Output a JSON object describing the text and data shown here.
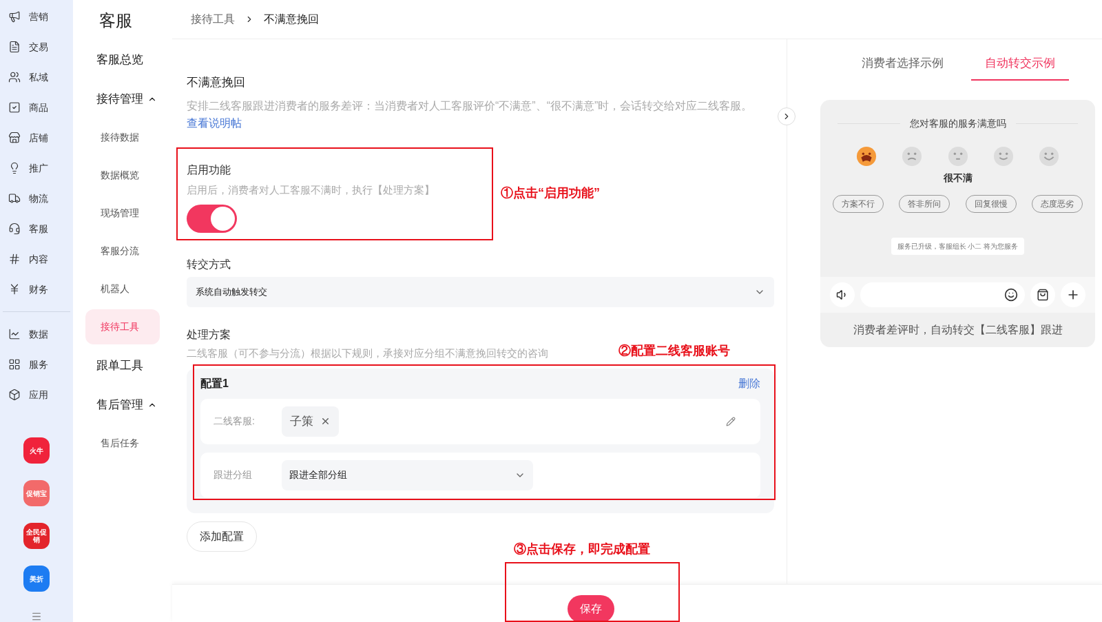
{
  "nav_rail": {
    "items": [
      {
        "label": "营销"
      },
      {
        "label": "交易"
      },
      {
        "label": "私域"
      },
      {
        "label": "商品"
      },
      {
        "label": "店铺"
      },
      {
        "label": "推广"
      },
      {
        "label": "物流"
      },
      {
        "label": "客服"
      },
      {
        "label": "内容"
      },
      {
        "label": "财务"
      },
      {
        "label": "数据"
      },
      {
        "label": "服务"
      },
      {
        "label": "应用"
      }
    ],
    "apps": [
      {
        "label": "火牛",
        "color": "#f0233b"
      },
      {
        "label": "促销宝",
        "color": "#f26a6a"
      },
      {
        "label": "全民促销",
        "color": "#e3242b"
      },
      {
        "label": "美折",
        "color": "#1d7cf2"
      }
    ]
  },
  "submenu": {
    "title": "客服",
    "items": [
      {
        "label": "客服总览",
        "kind": "link"
      },
      {
        "label": "接待管理",
        "kind": "group",
        "expanded": true,
        "children": [
          {
            "label": "接待数据",
            "selected": false
          },
          {
            "label": "数据概览",
            "selected": false
          },
          {
            "label": "现场管理",
            "selected": false
          },
          {
            "label": "客服分流",
            "selected": false
          },
          {
            "label": "机器人",
            "selected": false
          },
          {
            "label": "接待工具",
            "selected": true
          }
        ]
      },
      {
        "label": "跟单工具",
        "kind": "link"
      },
      {
        "label": "售后管理",
        "kind": "group",
        "expanded": true,
        "children": [
          {
            "label": "售后任务",
            "selected": false
          }
        ]
      }
    ]
  },
  "breadcrumb": [
    "接待工具",
    "不满意挽回"
  ],
  "form": {
    "title": "不满意挽回",
    "description": "安排二线客服跟进消费者的服务差评：当消费者对人工客服评价“不满意”、“很不满意”时，会话转交给对应二线客服。",
    "help_link": "查看说明帖",
    "enable": {
      "label": "启用功能",
      "hint": "启用后，消费者对人工客服不满时，执行【处理方案】",
      "on": true
    },
    "transfer": {
      "label": "转交方式",
      "value": "系统自动触发转交"
    },
    "plan": {
      "label": "处理方案",
      "hint": "二线客服（可不参与分流）根据以下规则，承接对应分组不满意挽回转交的咨询",
      "configs": [
        {
          "title": "配置1",
          "delete": "删除",
          "agent_label": "二线客服:",
          "agents": [
            "子策"
          ],
          "group_label": "跟进分组",
          "group_value": "跟进全部分组"
        }
      ]
    },
    "add_button": "添加配置",
    "save_button": "保存"
  },
  "annotations": [
    "①点击“启用功能”",
    "②配置二线客服账号",
    "③点击保存，即完成配置"
  ],
  "preview": {
    "tabs": [
      {
        "label": "消费者选择示例",
        "selected": false
      },
      {
        "label": "自动转交示例",
        "selected": true
      }
    ],
    "question": "您对客服的服务满意吗",
    "faces": [
      {
        "selected": true
      },
      {
        "selected": false
      },
      {
        "selected": false
      },
      {
        "selected": false
      },
      {
        "selected": false
      }
    ],
    "face_label": "很不满",
    "tags": [
      "方案不行",
      "答非所问",
      "回复很慢",
      "态度恶劣"
    ],
    "notice": "服务已升级，客服组长 小二 将为您服务",
    "caption": "消费者差评时，自动转交【二线客服】跟进"
  }
}
